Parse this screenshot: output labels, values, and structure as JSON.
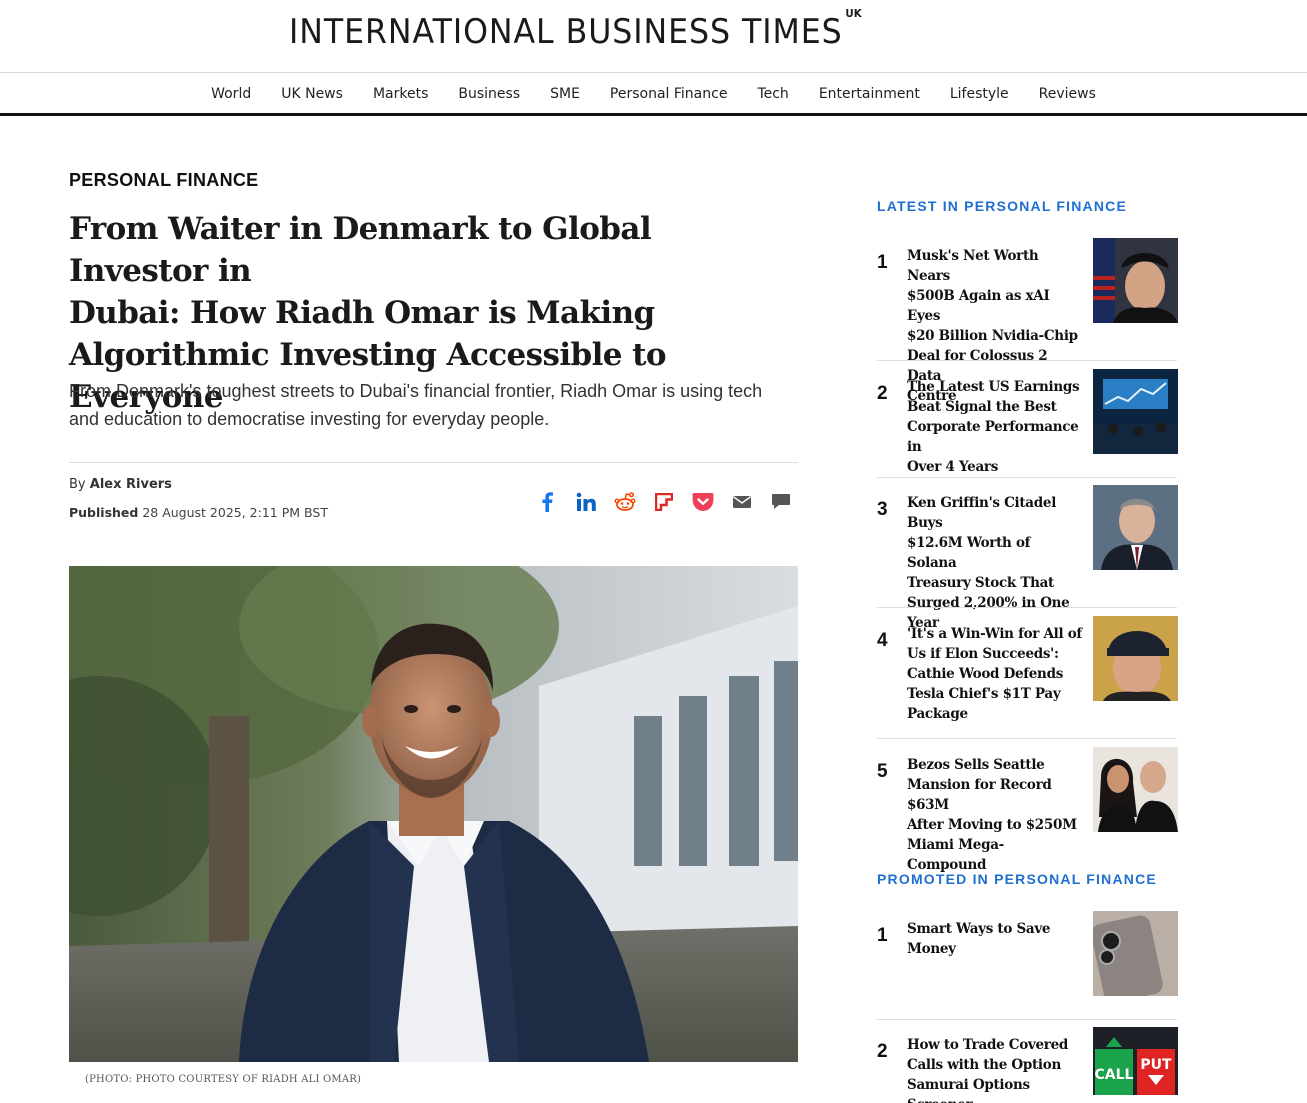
{
  "header": {
    "logo_text": "INTERNATIONAL BUSINESS TIMES",
    "logo_edition": "UK"
  },
  "nav": [
    "World",
    "UK News",
    "Markets",
    "Business",
    "SME",
    "Personal Finance",
    "Tech",
    "Entertainment",
    "Lifestyle",
    "Reviews"
  ],
  "article": {
    "category": "PERSONAL FINANCE",
    "title_lines": [
      "From Waiter in Denmark to Global Investor in",
      "Dubai: How Riadh Omar is Making",
      "Algorithmic Investing Accessible to Everyone"
    ],
    "standfirst_lines": [
      "From Denmark's toughest streets to Dubai's financial frontier, Riadh Omar is using tech",
      "and education to democratise investing for everyday people."
    ],
    "byline_prefix": "By",
    "author": "Alex Rivers",
    "published_label": "Published",
    "published_date": "28 August 2025, 2:11 PM BST",
    "caption": "(PHOTO: PHOTO COURTESY OF RIADH ALI OMAR)"
  },
  "share": [
    {
      "icon": "facebook-icon",
      "color": "#1877f2"
    },
    {
      "icon": "linkedin-icon",
      "color": "#0a66c2"
    },
    {
      "icon": "reddit-icon",
      "color": "#ff4500"
    },
    {
      "icon": "flipboard-icon",
      "color": "#e12828"
    },
    {
      "icon": "pocket-icon",
      "color": "#ef3f56"
    },
    {
      "icon": "email-icon",
      "color": "#555555"
    },
    {
      "icon": "comment-icon",
      "color": "#555555"
    }
  ],
  "sidebar": {
    "latest_title": "LATEST IN PERSONAL FINANCE",
    "latest": [
      {
        "num": "1",
        "lines": [
          "Musk's Net Worth Nears",
          "$500B Again as xAI Eyes",
          "$20 Billion Nvidia-Chip",
          "Deal for Colossus 2 Data",
          "Centre"
        ]
      },
      {
        "num": "2",
        "lines": [
          "The Latest US Earnings",
          "Beat Signal the Best",
          "Corporate Performance in",
          "Over 4 Years"
        ]
      },
      {
        "num": "3",
        "lines": [
          "Ken Griffin's Citadel Buys",
          "$12.6M Worth of Solana",
          "Treasury Stock That",
          "Surged 2,200% in One",
          "Year"
        ]
      },
      {
        "num": "4",
        "lines": [
          "'It's a Win-Win for All of",
          "Us if Elon Succeeds':",
          "Cathie Wood Defends",
          "Tesla Chief's $1T Pay",
          "Package"
        ]
      },
      {
        "num": "5",
        "lines": [
          "Bezos Sells Seattle",
          "Mansion for Record $63M",
          "After Moving to $250M",
          "Miami Mega-Compound"
        ]
      }
    ],
    "promoted_title": "PROMOTED IN PERSONAL FINANCE",
    "promoted": [
      {
        "num": "1",
        "lines": [
          "Smart Ways to Save",
          "Money"
        ]
      },
      {
        "num": "2",
        "lines": [
          "How to Trade Covered",
          "Calls with the Option",
          "Samurai Options Screener"
        ]
      }
    ],
    "thumb_call_label": "CALL",
    "thumb_put_label": "PUT"
  }
}
